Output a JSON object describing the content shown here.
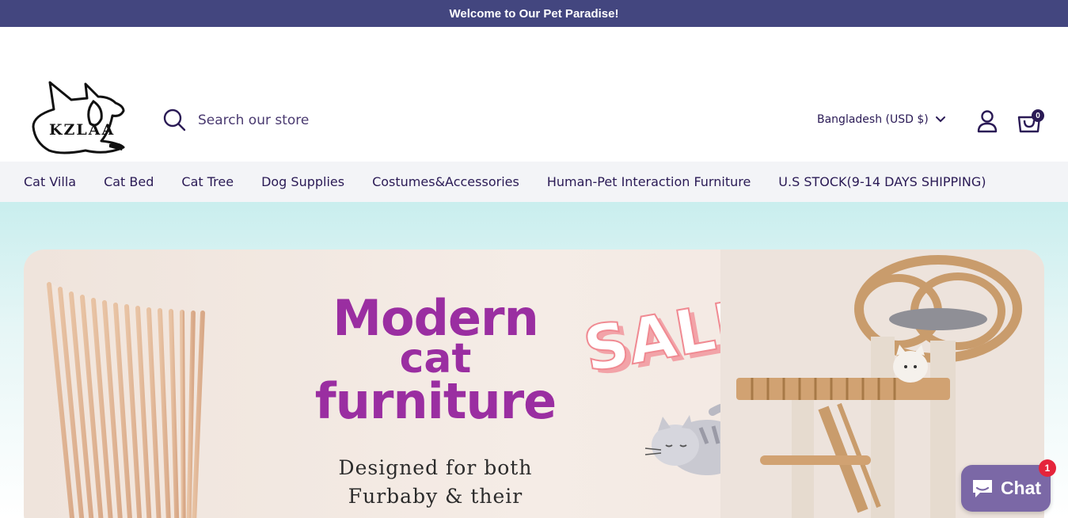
{
  "announcement": {
    "text": "Welcome to Our Pet Paradise!"
  },
  "header": {
    "logo_text": "KZLAA",
    "search": {
      "placeholder": "Search our store",
      "value": ""
    },
    "country_selector": "Bangladesh (USD $)",
    "cart_count": "0"
  },
  "nav": {
    "items": [
      {
        "label": "Cat Villa"
      },
      {
        "label": "Cat Bed"
      },
      {
        "label": "Cat Tree"
      },
      {
        "label": "Dog Supplies"
      },
      {
        "label": "Costumes&Accessories"
      },
      {
        "label": "Human-Pet Interaction Furniture"
      },
      {
        "label": "U.S STOCK(9-14 DAYS SHIPPING)"
      }
    ]
  },
  "hero": {
    "headline_line1": "Modern",
    "headline_line2": "cat",
    "headline_line3": "furniture",
    "sub_line1": "Designed for both",
    "sub_line2": "Furbaby & their",
    "sale_text": "SALE!"
  },
  "chat": {
    "label": "Chat",
    "badge": "1"
  },
  "colors": {
    "announcement_bg": "#43467f",
    "brand_text": "#2a1a55",
    "headline": "#9a2ea1",
    "chat_bg": "#7b68a6",
    "badge": "#e5243b"
  },
  "icons": [
    "search-icon",
    "chevron-down-icon",
    "account-icon",
    "cart-icon",
    "chat-icon"
  ]
}
